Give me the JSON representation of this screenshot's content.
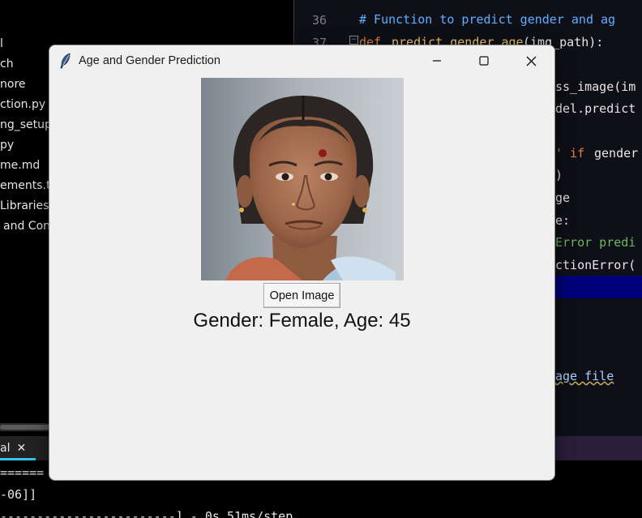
{
  "explorer": {
    "files": [
      "l",
      "ch",
      "nore",
      "ction.py",
      "ng_setup.p",
      "py",
      "me.md",
      "ements.tx",
      "Libraries",
      "and Con"
    ]
  },
  "editor": {
    "line_numbers": [
      "36",
      "37"
    ],
    "lines": [
      {
        "text": "# Function to predict gender and ag",
        "kind": "comment"
      },
      {
        "text": "def",
        "kind": "kw"
      },
      {
        "text": "predict_gender_age",
        "kind": "fn"
      },
      {
        "text": "(img_path):",
        "kind": "plain"
      },
      {
        "text": "ss_image(im",
        "kind": "plain"
      },
      {
        "text": "del.predict",
        "kind": "plain"
      },
      {
        "text": "' if",
        "kind": "kw"
      },
      {
        "text": "gender",
        "kind": "plain"
      },
      {
        "text": ")",
        "kind": "plain"
      },
      {
        "text": "ge",
        "kind": "plain"
      },
      {
        "text": "e:",
        "kind": "plain"
      },
      {
        "text": "Error predi",
        "kind": "str"
      },
      {
        "text": "ctionError(",
        "kind": "plain"
      },
      {
        "text": "age file",
        "kind": "squig"
      }
    ]
  },
  "terminal": {
    "tab_label": "al",
    "lines": [
      "======",
      "-06]]",
      "------------------------] - 0s 51ms/step"
    ]
  },
  "window": {
    "title": "Age and Gender Prediction",
    "open_button_label": "Open Image",
    "result_text": "Gender: Female, Age: 45"
  },
  "colors": {
    "window_bg": "#f0f0f0",
    "terminal_accent": "#35c4ea",
    "editor_highlight": "#00007a"
  }
}
